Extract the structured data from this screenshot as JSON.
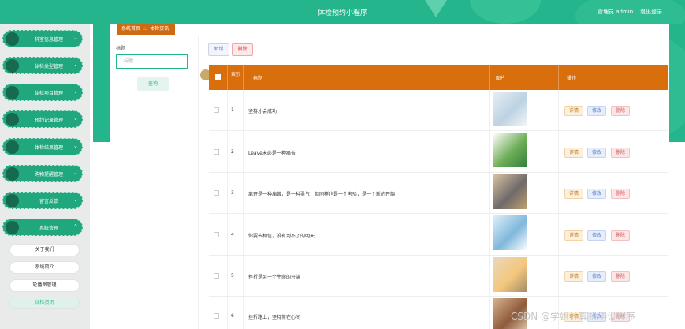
{
  "header": {
    "title": "体检预约小程序",
    "user": "管理员 admin",
    "logout": "退出登录"
  },
  "sidebar": {
    "items": [
      {
        "label": "科室信息管理"
      },
      {
        "label": "体检类型管理"
      },
      {
        "label": "体检项目管理"
      },
      {
        "label": "预约记录管理"
      },
      {
        "label": "体检结果管理"
      },
      {
        "label": "购物提醒管理"
      },
      {
        "label": "留言反馈"
      },
      {
        "label": "系统管理"
      }
    ],
    "sub_items": [
      {
        "label": "关于我们"
      },
      {
        "label": "系统简介"
      },
      {
        "label": "轮播图管理"
      },
      {
        "label": "体检资讯"
      }
    ]
  },
  "breadcrumb": {
    "home": "系统首页",
    "separator": "::",
    "current": "体检资讯"
  },
  "filter": {
    "label": "标题",
    "placeholder": "标题",
    "query_button": "查询"
  },
  "toolbar": {
    "add": "新增",
    "delete": "删除"
  },
  "table": {
    "columns": {
      "index": "索引",
      "title": "标题",
      "image": "图片",
      "actions": "操作"
    },
    "actions": {
      "detail": "详情",
      "edit": "修改",
      "delete": "删除"
    },
    "rows": [
      {
        "index": "1",
        "title": "坚持才会成功"
      },
      {
        "index": "2",
        "title": "Leave未必是一种痛苦"
      },
      {
        "index": "3",
        "title": "离开是一种痛苦，是一种勇气，但同样也是一个考验，是一个新的开端"
      },
      {
        "index": "4",
        "title": "你要去相信，没有到不了的明天"
      },
      {
        "index": "5",
        "title": "挫折是另一个生命的开端"
      },
      {
        "index": "6",
        "title": "挫折路上，坚持常在心间"
      }
    ]
  },
  "watermark": "CSDN @学姐计算机毕设程序",
  "colors": {
    "accent": "#25b58c",
    "header_orange": "#d86e0c"
  }
}
